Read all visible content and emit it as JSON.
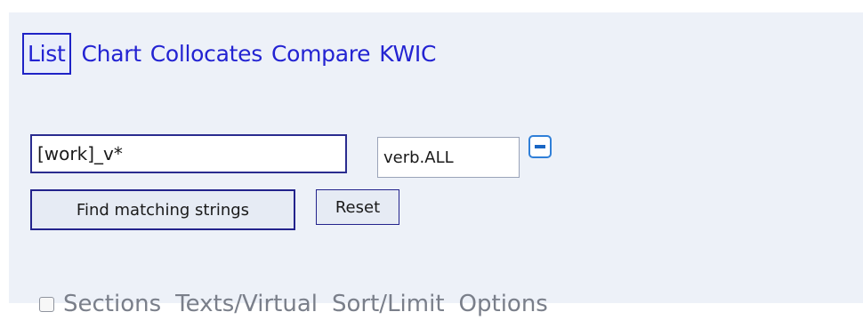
{
  "nav": {
    "tabs": [
      {
        "label": "List",
        "active": true
      },
      {
        "label": "Chart"
      },
      {
        "label": "Collocates"
      },
      {
        "label": "Compare"
      },
      {
        "label": "KWIC"
      }
    ]
  },
  "search": {
    "query_value": "[work]_v*",
    "pos_value": "verb.ALL",
    "minus_icon": "minus-icon"
  },
  "buttons": {
    "find_label": "Find matching strings",
    "reset_label": "Reset"
  },
  "options_row": {
    "sections_checked": false,
    "items": [
      "Sections",
      "Texts/Virtual",
      "Sort/Limit",
      "Options"
    ]
  },
  "colors": {
    "link": "#2323d2",
    "panel_bg": "#edf1f8",
    "button_border": "#23238c",
    "muted_text": "#7a7f8a"
  }
}
